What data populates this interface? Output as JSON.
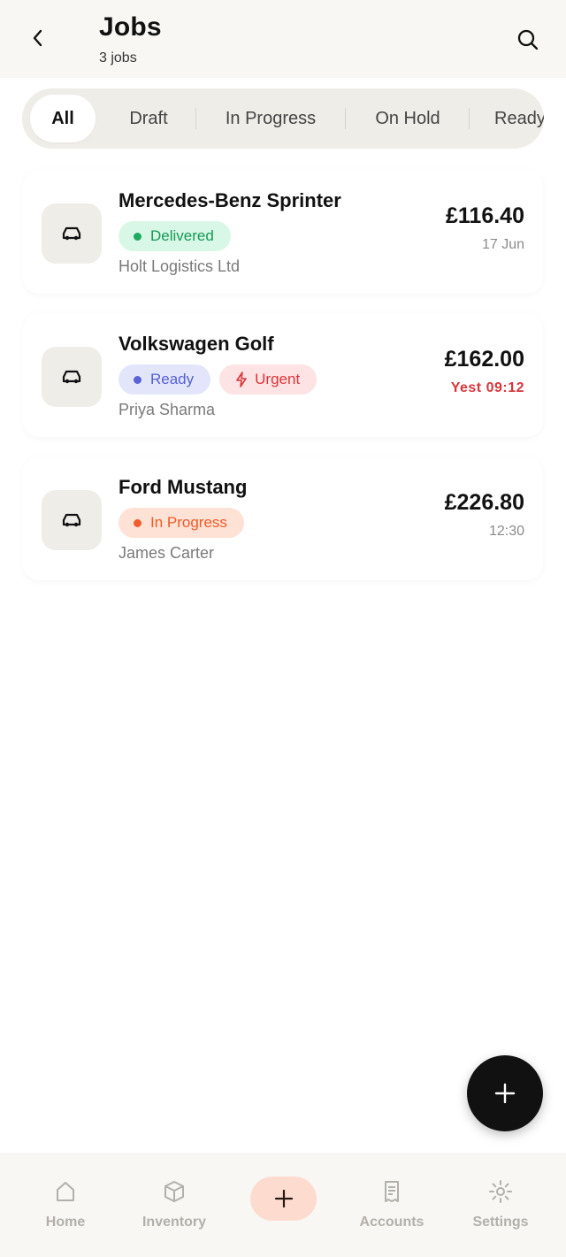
{
  "header": {
    "title": "Jobs",
    "subtitle": "3 jobs"
  },
  "tabs": [
    {
      "label": "All",
      "active": true
    },
    {
      "label": "Draft",
      "active": false
    },
    {
      "label": "In Progress",
      "active": false
    },
    {
      "label": "On Hold",
      "active": false
    },
    {
      "label": "Ready",
      "active": false
    }
  ],
  "jobs": [
    {
      "vehicle": "Mercedes-Benz Sprinter",
      "status": "Delivered",
      "customer": "Holt Logistics Ltd",
      "price": "£116.40",
      "when": "17 Jun",
      "icon": "car-icon"
    },
    {
      "vehicle": "Volkswagen Golf",
      "status": "Ready",
      "priority": "Urgent",
      "customer": "Priya Sharma",
      "price": "£162.00",
      "when": "Yest 09:12",
      "icon": "car-icon"
    },
    {
      "vehicle": "Ford Mustang",
      "status": "In Progress",
      "customer": "James Carter",
      "price": "£226.80",
      "when": "12:30",
      "icon": "car-icon"
    }
  ],
  "nav": {
    "home": "Home",
    "inventory": "Inventory",
    "accounts": "Accounts",
    "settings": "Settings"
  },
  "colors": {
    "accent": "#111111",
    "delivered": "#1dab5f",
    "ready": "#5a63d6",
    "urgent": "#d8363b",
    "in_progress": "#f05d2a",
    "center_button": "#fddccf"
  }
}
